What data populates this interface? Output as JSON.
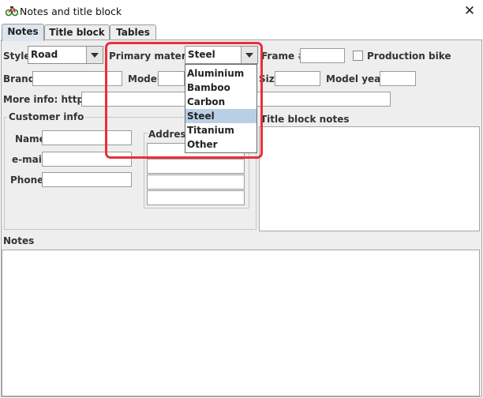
{
  "window": {
    "title": "Notes and title block",
    "close_glyph": "✕"
  },
  "tabs": [
    {
      "label": "Notes",
      "active": true
    },
    {
      "label": "Title block",
      "active": false
    },
    {
      "label": "Tables",
      "active": false
    }
  ],
  "form": {
    "style_label": "Style",
    "style_value": "Road",
    "primary_material_label": "Primary material",
    "primary_material_value": "Steel",
    "frame_label": "Frame #",
    "frame_value": "",
    "production_bike_label": "Production bike",
    "production_bike_checked": false,
    "brand_label": "Brand",
    "brand_value": "",
    "model_label": "Model",
    "model_value": "",
    "size_label": "Size",
    "size_value": "",
    "model_year_label": "Model year",
    "model_year_value": "",
    "more_info_label": "More info: http://",
    "more_info_value": ""
  },
  "material_options": [
    "Aluminium",
    "Bamboo",
    "Carbon",
    "Steel",
    "Titanium",
    "Other"
  ],
  "material_selected_index": 3,
  "customer_info": {
    "title": "Customer info",
    "name_label": "Name",
    "email_label": "e-mail",
    "phone_label": "Phone",
    "address_label": "Address"
  },
  "title_block_notes_label": "Title block notes",
  "notes_label": "Notes",
  "colors": {
    "highlight": "#e8303a",
    "selected_option": "#b8cfe5",
    "active_tab": "#dce5f0"
  }
}
